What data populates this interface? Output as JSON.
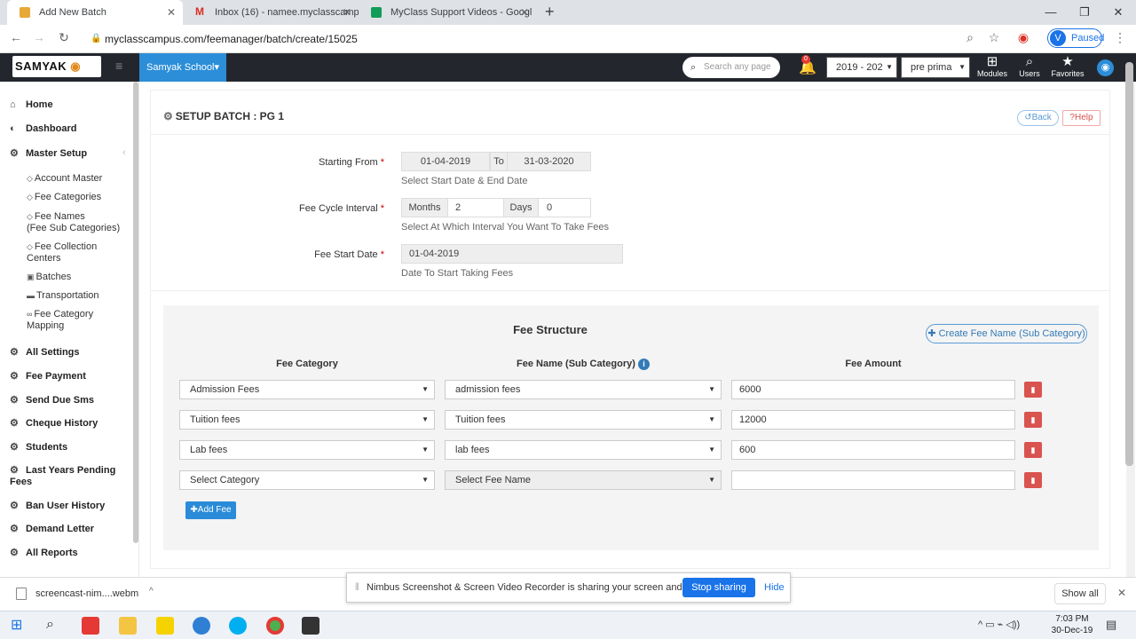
{
  "browser": {
    "tabs": [
      {
        "title": "Add New Batch",
        "active": true
      },
      {
        "title": "Inbox (16) - namee.myclasscamp",
        "active": false
      },
      {
        "title": "MyClass Support Videos - Googl",
        "active": false
      }
    ],
    "new_tab": "+",
    "url": "myclasscampus.com/feemanager/batch/create/15025",
    "profile_initial": "V",
    "profile_status": "Paused"
  },
  "header": {
    "logo": "SAMYAK",
    "school": "Samyak School",
    "search_placeholder": "Search any page",
    "notification_count": "0",
    "year": "2019 - 202",
    "class": "pre prima",
    "icons": [
      {
        "label": "Modules",
        "icon": "grid-icon"
      },
      {
        "label": "Users",
        "icon": "search-icon"
      },
      {
        "label": "Favorites",
        "icon": "star-icon"
      }
    ]
  },
  "sidebar": {
    "items": [
      {
        "label": "Home",
        "icon": "home-icon"
      },
      {
        "label": "Dashboard",
        "icon": "dashboard-icon"
      },
      {
        "label": "Master Setup",
        "icon": "gear-icon"
      },
      {
        "label": "All Settings",
        "icon": "gear-icon"
      },
      {
        "label": "Fee Payment",
        "icon": "gear-icon"
      },
      {
        "label": "Send Due Sms",
        "icon": "gear-icon"
      },
      {
        "label": "Cheque History",
        "icon": "gear-icon"
      },
      {
        "label": "Students",
        "icon": "gear-icon"
      },
      {
        "label": "Last Years Pending Fees",
        "icon": "gear-icon"
      },
      {
        "label": "Ban User History",
        "icon": "gear-icon"
      },
      {
        "label": "Demand Letter",
        "icon": "gear-icon"
      },
      {
        "label": "All Reports",
        "icon": "gear-icon"
      }
    ],
    "sub_items": [
      {
        "label": "Account Master",
        "icon": "tag-icon"
      },
      {
        "label": "Fee Categories",
        "icon": "tag-icon"
      },
      {
        "label": "Fee Names",
        "sub": "(Fee Sub Categories)",
        "icon": "tag-icon"
      },
      {
        "label": "Fee Collection",
        "sub": "Centers",
        "icon": "tag-icon"
      },
      {
        "label": "Batches",
        "icon": "calendar-icon"
      },
      {
        "label": "Transportation",
        "icon": "bus-icon"
      },
      {
        "label": "Fee Category",
        "sub": "Mapping",
        "icon": "link-icon"
      }
    ]
  },
  "page": {
    "title": "SETUP BATCH : PG 1",
    "back": "Back",
    "help": "Help",
    "starting_from_label": "Starting From",
    "start_date": "01-04-2019",
    "to_label": "To",
    "end_date": "31-03-2020",
    "date_help": "Select Start Date & End Date",
    "cycle_label": "Fee Cycle Interval",
    "months_label": "Months",
    "months_value": "2",
    "days_label": "Days",
    "days_value": "0",
    "cycle_help": "Select At Which Interval You Want To Take Fees",
    "fee_start_label": "Fee Start Date",
    "fee_start_value": "01-04-2019",
    "fee_start_help": "Date To Start Taking Fees",
    "required_mark": "*"
  },
  "fee_structure": {
    "title": "Fee Structure",
    "create_button": "Create Fee Name (Sub Category)",
    "columns": [
      "Fee Category",
      "Fee Name (Sub Category)",
      "Fee Amount"
    ],
    "rows": [
      {
        "category": "Admission Fees",
        "name": "admission fees",
        "amount": "6000"
      },
      {
        "category": "Tuition fees",
        "name": "Tuition fees",
        "amount": "12000"
      },
      {
        "category": "Lab fees",
        "name": "lab fees",
        "amount": "600"
      },
      {
        "category": "Select Category",
        "name": "Select Fee Name",
        "amount": ""
      }
    ],
    "add_button": "Add Fee"
  },
  "downloads": {
    "file": "screencast-nim....webm",
    "show_all": "Show all"
  },
  "share_notice": {
    "text": "Nimbus Screenshot & Screen Video Recorder is sharing your screen and audio.",
    "stop": "Stop sharing",
    "hide": "Hide"
  },
  "taskbar": {
    "time": "7:03 PM",
    "date": "30-Dec-19"
  }
}
